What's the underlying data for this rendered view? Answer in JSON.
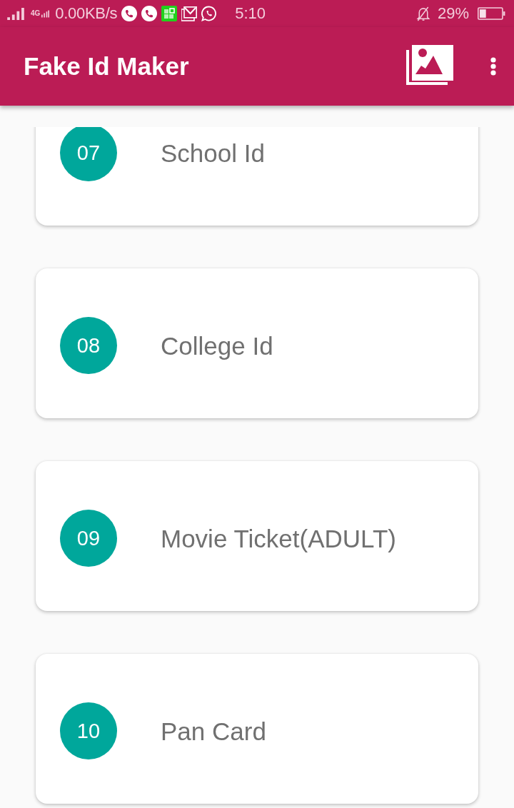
{
  "status_bar": {
    "network_type": "4G",
    "data_rate": "0.00KB/s",
    "time": "5:10",
    "battery": "29%"
  },
  "app_bar": {
    "title": "Fake Id Maker"
  },
  "items": [
    {
      "number": "07",
      "label": "School Id"
    },
    {
      "number": "08",
      "label": "College Id"
    },
    {
      "number": "09",
      "label": "Movie Ticket(ADULT)"
    },
    {
      "number": "10",
      "label": "Pan Card"
    }
  ]
}
